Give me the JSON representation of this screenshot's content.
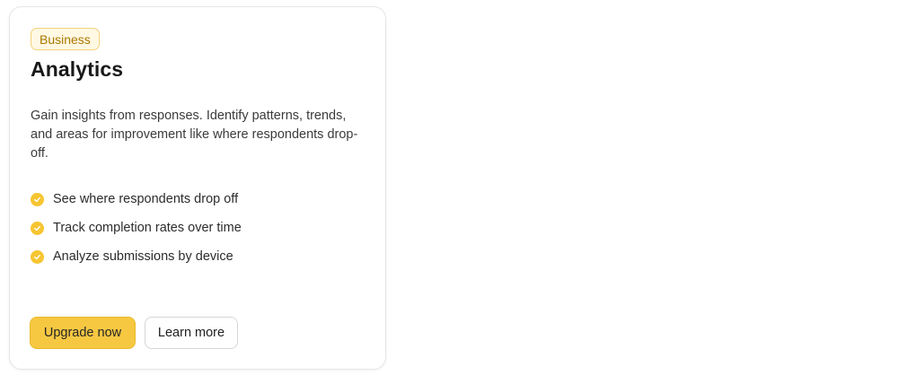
{
  "card": {
    "badge": "Business",
    "title": "Analytics",
    "description": "Gain insights from responses. Identify patterns, trends, and areas for improvement like where respondents drop-off.",
    "features": [
      {
        "label": "See where respondents drop off",
        "icon": "check-circle-icon"
      },
      {
        "label": "Track completion rates over time",
        "icon": "check-circle-icon"
      },
      {
        "label": "Analyze submissions by device",
        "icon": "check-circle-icon"
      }
    ],
    "buttons": {
      "primary_label": "Upgrade now",
      "secondary_label": "Learn more"
    }
  },
  "colors": {
    "accent": "#f6c842",
    "badge_text": "#a97800",
    "badge_bg": "#fff8e3",
    "check": "#f6c531"
  }
}
